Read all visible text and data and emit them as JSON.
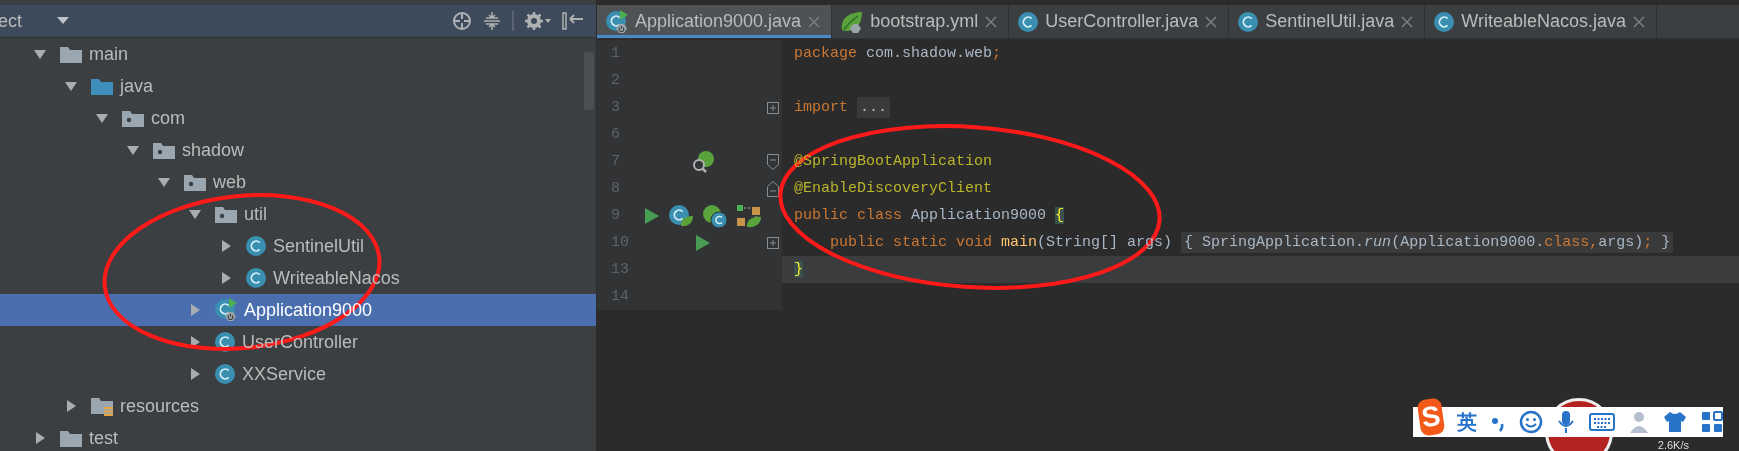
{
  "project_panel": {
    "title": "ect",
    "tree": [
      {
        "label": "main",
        "kind": "folder",
        "expanded": true,
        "selected": false,
        "children": [
          {
            "label": "java",
            "kind": "source-folder",
            "expanded": true,
            "selected": false,
            "children": [
              {
                "label": "com",
                "kind": "package",
                "expanded": true,
                "selected": false,
                "children": [
                  {
                    "label": "shadow",
                    "kind": "package",
                    "expanded": true,
                    "selected": false,
                    "children": [
                      {
                        "label": "web",
                        "kind": "package",
                        "expanded": true,
                        "selected": false,
                        "children": [
                          {
                            "label": "util",
                            "kind": "package",
                            "expanded": true,
                            "selected": false,
                            "children": [
                              {
                                "label": "SentinelUtil",
                                "kind": "class",
                                "expanded": false,
                                "selected": false
                              },
                              {
                                "label": "WriteableNacos",
                                "kind": "class",
                                "expanded": false,
                                "selected": false
                              }
                            ]
                          },
                          {
                            "label": "Application9000",
                            "kind": "spring-class",
                            "expanded": false,
                            "selected": true
                          },
                          {
                            "label": "UserController",
                            "kind": "class",
                            "expanded": false,
                            "selected": false
                          },
                          {
                            "label": "XXService",
                            "kind": "class",
                            "expanded": false,
                            "selected": false
                          }
                        ]
                      }
                    ]
                  }
                ]
              }
            ]
          },
          {
            "label": "resources",
            "kind": "resources-folder",
            "expanded": false,
            "selected": false
          }
        ]
      },
      {
        "label": "test",
        "kind": "folder",
        "expanded": false,
        "selected": false
      }
    ]
  },
  "editor": {
    "tabs": [
      {
        "label": "Application9000.java",
        "kind": "spring-class",
        "selected": true
      },
      {
        "label": "bootstrap.yml",
        "kind": "spring-config",
        "selected": false
      },
      {
        "label": "UserController.java",
        "kind": "class",
        "selected": false
      },
      {
        "label": "SentinelUtil.java",
        "kind": "class",
        "selected": false
      },
      {
        "label": "WriteableNacos.java",
        "kind": "class",
        "selected": false
      }
    ],
    "lines": [
      {
        "number": "1",
        "current": false,
        "tokens": [
          {
            "kind": "keyword",
            "text": "package"
          },
          {
            "kind": "plain",
            "text": " com.shadow.web"
          },
          {
            "kind": "keyword",
            "text": ";"
          }
        ]
      },
      {
        "number": "2",
        "current": false
      },
      {
        "number": "3",
        "current": false,
        "tokens": [
          {
            "kind": "keyword",
            "text": "import"
          },
          {
            "kind": "fold",
            "tokens": [
              {
                "kind": "plain",
                "text": "..."
              }
            ]
          }
        ]
      },
      {
        "number": "6",
        "current": false
      },
      {
        "number": "7",
        "current": false,
        "tokens": [
          {
            "kind": "annotation",
            "text": "@SpringBootApplication"
          }
        ]
      },
      {
        "number": "8",
        "current": false,
        "tokens": [
          {
            "kind": "annotation",
            "text": "@EnableDiscoveryClient"
          }
        ]
      },
      {
        "number": "9",
        "current": false,
        "tokens": [
          {
            "kind": "keyword",
            "text": "public class"
          },
          {
            "kind": "plain",
            "text": " Application9000 "
          },
          {
            "kind": "brace",
            "text": "{"
          }
        ]
      },
      {
        "number": "10",
        "current": false,
        "indented": true,
        "tokens": [
          {
            "kind": "keyword",
            "text": "public static void"
          },
          {
            "kind": "method",
            "text": " main"
          },
          {
            "kind": "plain",
            "text": "(String[] args)"
          },
          {
            "kind": "fold",
            "tokens": [
              {
                "kind": "plain",
                "text": "{ SpringApplication."
              },
              {
                "kind": "italic",
                "text": "run"
              },
              {
                "kind": "plain",
                "text": "(Application9000."
              },
              {
                "kind": "keyword",
                "text": "class,"
              },
              {
                "kind": "plain",
                "text": "args)"
              },
              {
                "kind": "keyword",
                "text": ";"
              },
              {
                "kind": "plain",
                "text": " }"
              }
            ]
          }
        ]
      },
      {
        "number": "13",
        "current": true,
        "tokens": [
          {
            "kind": "brace",
            "text": "}"
          }
        ]
      },
      {
        "number": "14",
        "current": false
      }
    ]
  },
  "ime_toolbar": {
    "logo": "S",
    "mode": "英"
  },
  "network_speed": "2.6K/s"
}
